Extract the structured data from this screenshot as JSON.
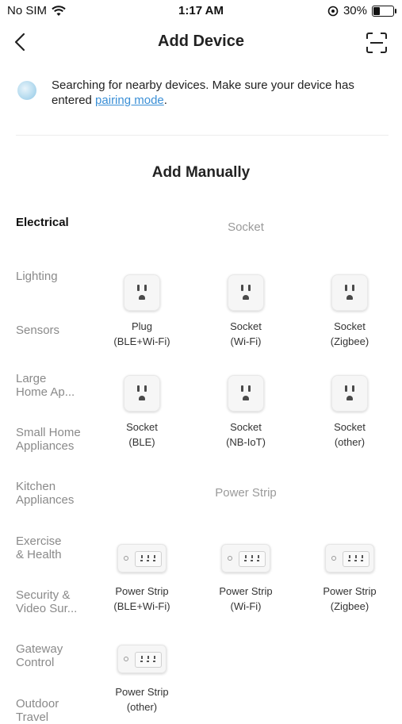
{
  "status": {
    "carrier": "No SIM",
    "time": "1:17 AM",
    "battery": "30%"
  },
  "nav": {
    "title": "Add Device"
  },
  "banner": {
    "text_before": "Searching for nearby devices. Make sure your device has entered ",
    "link": "pairing mode",
    "text_after": "."
  },
  "section_title": "Add Manually",
  "sidebar": {
    "items": [
      {
        "label": "Electrical"
      },
      {
        "label": "Lighting"
      },
      {
        "label": "Sensors"
      },
      {
        "label": "Large\nHome Ap..."
      },
      {
        "label": "Small Home\nAppliances"
      },
      {
        "label": "Kitchen\nAppliances"
      },
      {
        "label": "Exercise\n& Health"
      },
      {
        "label": "Security &\nVideo Sur..."
      },
      {
        "label": "Gateway\nControl"
      },
      {
        "label": "Outdoor\nTravel"
      }
    ]
  },
  "groups": {
    "socket": {
      "title": "Socket",
      "devices": [
        {
          "name": "Plug",
          "sub": "(BLE+Wi-Fi)"
        },
        {
          "name": "Socket",
          "sub": "(Wi-Fi)"
        },
        {
          "name": "Socket",
          "sub": "(Zigbee)"
        },
        {
          "name": "Socket",
          "sub": "(BLE)"
        },
        {
          "name": "Socket",
          "sub": "(NB-IoT)"
        },
        {
          "name": "Socket",
          "sub": "(other)"
        }
      ]
    },
    "power_strip": {
      "title": "Power Strip",
      "devices": [
        {
          "name": "Power Strip",
          "sub": "(BLE+Wi-Fi)"
        },
        {
          "name": "Power Strip",
          "sub": "(Wi-Fi)"
        },
        {
          "name": "Power Strip",
          "sub": "(Zigbee)"
        },
        {
          "name": "Power Strip",
          "sub": "(other)"
        }
      ]
    }
  }
}
